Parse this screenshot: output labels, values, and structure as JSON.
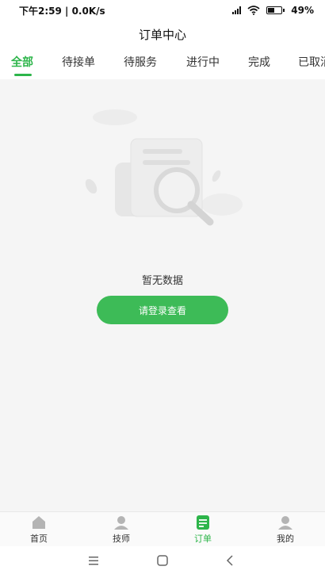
{
  "status_bar": {
    "time_speed": "下午2:59 | 0.0K/s",
    "battery": "49%",
    "battery_level": 0.49
  },
  "header": {
    "title": "订单中心"
  },
  "tabs": [
    {
      "label": "全部",
      "active": true
    },
    {
      "label": "待接单",
      "active": false
    },
    {
      "label": "待服务",
      "active": false
    },
    {
      "label": "进行中",
      "active": false
    },
    {
      "label": "完成",
      "active": false
    },
    {
      "label": "已取消",
      "active": false
    }
  ],
  "empty_state": {
    "message": "暂无数据",
    "button_label": "请登录查看",
    "icon": "search-document-icon"
  },
  "bottom_nav": [
    {
      "label": "首页",
      "icon": "home-icon",
      "active": false
    },
    {
      "label": "技师",
      "icon": "technician-icon",
      "active": false
    },
    {
      "label": "订单",
      "icon": "order-list-icon",
      "active": true
    },
    {
      "label": "我的",
      "icon": "user-icon",
      "active": false
    }
  ],
  "colors": {
    "accent": "#2db54a",
    "button": "#3dbb57",
    "background": "#f5f5f5"
  }
}
